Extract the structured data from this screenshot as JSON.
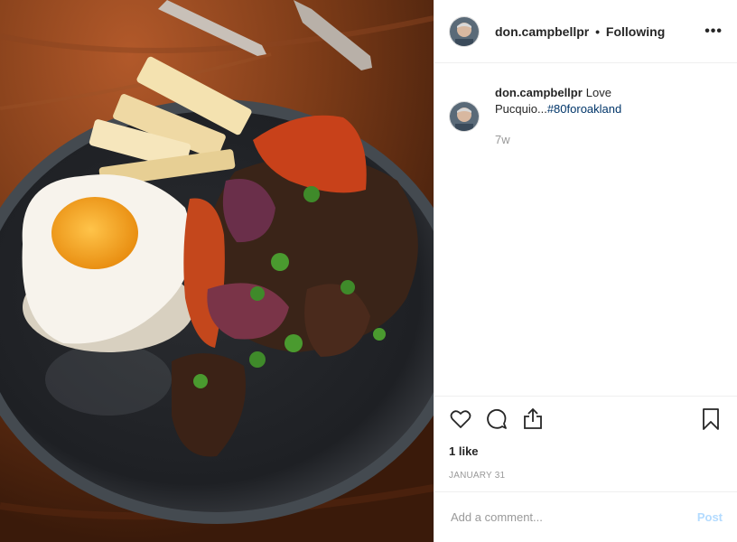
{
  "post": {
    "photo_alt": "photo",
    "header": {
      "username": "don.campbellpr",
      "separator": "•",
      "follow_status": "Following",
      "more_label": "•••",
      "more_icon": "more-options-icon"
    },
    "caption": {
      "username": "don.campbellpr",
      "text": "Love Pucquio...",
      "hashtag": "#80foroakland",
      "time": "7w"
    },
    "actions": {
      "icons": [
        "heart-icon",
        "comment-icon",
        "share-icon",
        "bookmark-icon"
      ]
    },
    "likes": "1 like",
    "date": "JANUARY 31",
    "add_comment": {
      "placeholder": "Add a comment...",
      "post_label": "Post"
    },
    "colors": {
      "link": "#003569",
      "post_button": "#b3dbff",
      "muted": "#999999"
    }
  }
}
